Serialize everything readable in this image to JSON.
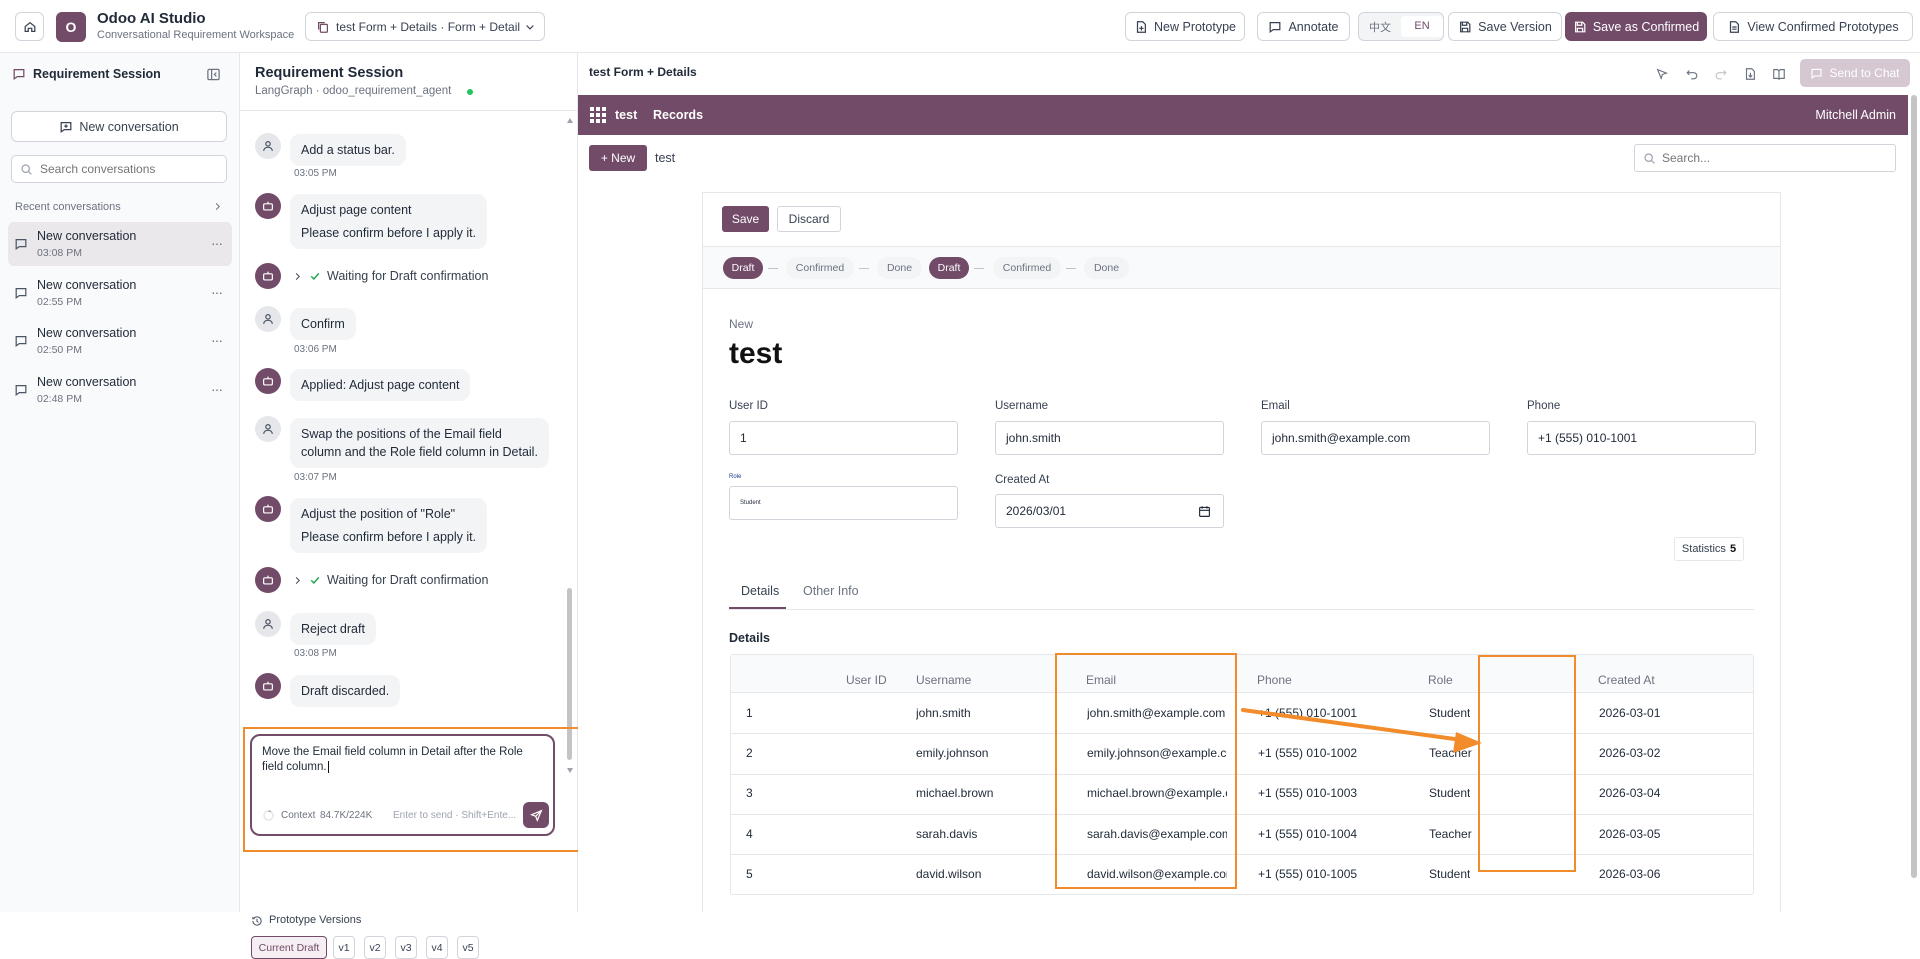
{
  "app": {
    "logo_letter": "O",
    "title": "Odoo AI Studio",
    "subtitle": "Conversational Requirement Workspace"
  },
  "topbar": {
    "prototype_tab": "test Form + Details · Form + Detail",
    "new_prototype": "New Prototype",
    "annotate": "Annotate",
    "lang_zh": "中文",
    "lang_en": "EN",
    "save_version": "Save Version",
    "save_confirmed": "Save as Confirmed",
    "view_confirmed": "View Confirmed Prototypes"
  },
  "sidebar": {
    "title": "Requirement Session",
    "new_conversation": "New conversation",
    "search_placeholder": "Search conversations",
    "recent_label": "Recent conversations",
    "items": [
      {
        "title": "New conversation",
        "time": "03:08 PM"
      },
      {
        "title": "New conversation",
        "time": "02:55 PM"
      },
      {
        "title": "New conversation",
        "time": "02:50 PM"
      },
      {
        "title": "New conversation",
        "time": "02:48 PM"
      }
    ]
  },
  "chat": {
    "title": "Requirement Session",
    "subtitle": "LangGraph · odoo_requirement_agent",
    "messages": {
      "m1": "Add a status bar.",
      "m1_time": "03:05 PM",
      "m2_l1": "Adjust page content",
      "m2_l2": "Please confirm before I apply it.",
      "m3": "Waiting for Draft confirmation",
      "m4": "Confirm",
      "m4_time": "03:06 PM",
      "m5": "Applied: Adjust page content",
      "m6_l1": "Swap the positions of the Email field",
      "m6_l2": "column and the Role field column in Detail.",
      "m6_time": "03:07 PM",
      "m7_l1": "Adjust the position of \"Role\"",
      "m7_l2": "Please confirm before I apply it.",
      "m8": "Waiting for Draft confirmation",
      "m9": "Reject draft",
      "m9_time": "03:08 PM",
      "m10": "Draft discarded."
    },
    "input_line1": "Move the Email field column in Detail after the Role",
    "input_line2": "field column.",
    "context_label": "Context",
    "context_value": "84.7K/224K",
    "send_hint": "Enter to send · Shift+Ente...",
    "versions_label": "Prototype Versions",
    "versions": [
      "Current Draft",
      "v1",
      "v2",
      "v3",
      "v4",
      "v5"
    ]
  },
  "preview": {
    "title": "test Form + Details",
    "send_to_chat": "Send to Chat",
    "odoo_app": "test",
    "odoo_menu": "Records",
    "user": "Mitchell Admin",
    "new_button": "+ New",
    "breadcrumb": "test",
    "search_placeholder": "Search...",
    "save": "Save",
    "discard": "Discard",
    "statusbar": [
      "Draft",
      "Confirmed",
      "Done",
      "Draft",
      "Confirmed",
      "Done"
    ],
    "record_label": "New",
    "record_title": "test",
    "fields": {
      "user_id_label": "User ID",
      "user_id": "1",
      "username_label": "Username",
      "username": "john.smith",
      "email_label": "Email",
      "email": "john.smith@example.com",
      "phone_label": "Phone",
      "phone": "+1 (555) 010-1001",
      "role_label": "Role",
      "role": "Student",
      "created_label": "Created At",
      "created": "2026/03/01"
    },
    "stat_label": "Statistics",
    "stat_value": "5",
    "tabs": [
      "Details",
      "Other Info"
    ],
    "section_title": "Details",
    "columns": [
      "User ID",
      "Username",
      "Email",
      "Phone",
      "Role",
      "Created At"
    ],
    "rows": [
      [
        "1",
        "john.smith",
        "john.smith@example.com",
        "+1 (555) 010-1001",
        "Student",
        "2026-03-01"
      ],
      [
        "2",
        "emily.johnson",
        "emily.johnson@example.com",
        "+1 (555) 010-1002",
        "Teacher",
        "2026-03-02"
      ],
      [
        "3",
        "michael.brown",
        "michael.brown@example.com",
        "+1 (555) 010-1003",
        "Student",
        "2026-03-04"
      ],
      [
        "4",
        "sarah.davis",
        "sarah.davis@example.com",
        "+1 (555) 010-1004",
        "Teacher",
        "2026-03-05"
      ],
      [
        "5",
        "david.wilson",
        "david.wilson@example.com",
        "+1 (555) 010-1005",
        "Student",
        "2026-03-06"
      ]
    ]
  },
  "colors": {
    "brand": "#714b67",
    "annotation": "#f28b2a",
    "online": "#22c55e",
    "check": "#16a34a"
  }
}
